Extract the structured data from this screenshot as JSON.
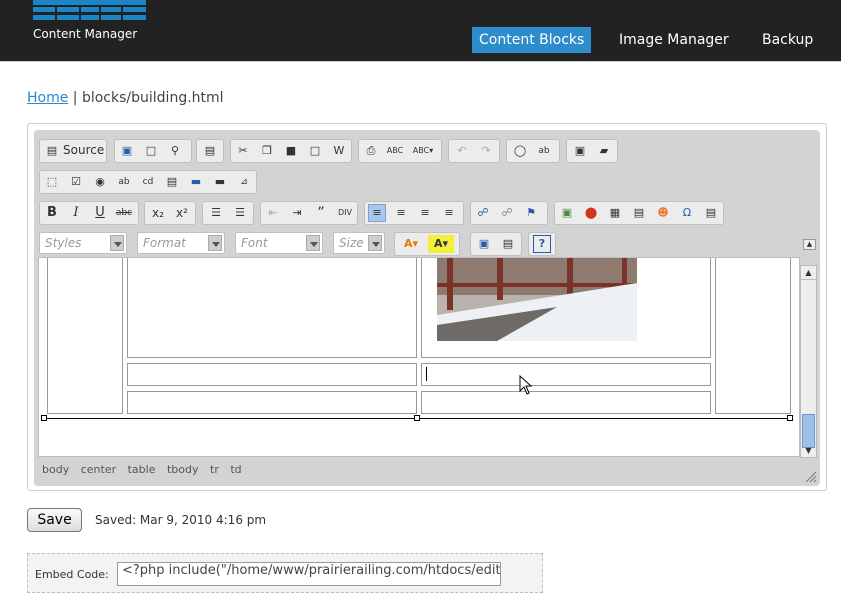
{
  "header": {
    "logo_text": "Content Manager",
    "nav": [
      "Content Blocks",
      "Image Manager",
      "Backup"
    ]
  },
  "breadcrumb": {
    "home": "Home",
    "separator": " | ",
    "path": "blocks/building.html"
  },
  "toolbar": {
    "source": "Source",
    "styles": "Styles",
    "format": "Format",
    "font": "Font",
    "size": "Size"
  },
  "status_path": [
    "body",
    "center",
    "table",
    "tbody",
    "tr",
    "td"
  ],
  "save": {
    "label": "Save",
    "status": "Saved: Mar 9, 2010 4:16 pm"
  },
  "embed": {
    "label": "Embed Code:",
    "value": "<?php include(\"/home/www/prairierailing.com/htdocs/edit"
  },
  "colors": {
    "accent": "#2d8ccc",
    "header_bg": "#222222"
  }
}
